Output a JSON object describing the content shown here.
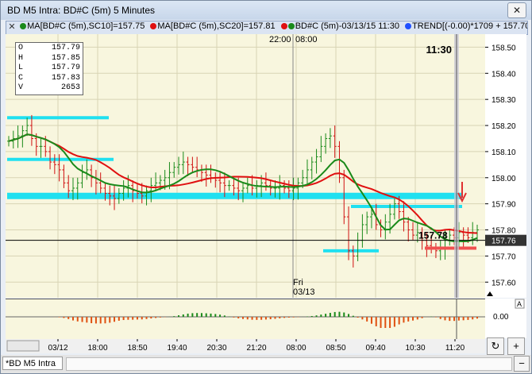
{
  "window": {
    "title": "BD M5 Intra: BD#C (5m) 5 Minutes",
    "close": "✕"
  },
  "legend": {
    "close_x": "✕",
    "items": [
      {
        "text": "MA[BD#C (5m),SC10]=157.75",
        "color": "#1a8a1a"
      },
      {
        "text": "MA[BD#C (5m),SC20]=157.81",
        "color": "#e01010"
      },
      {
        "text": "BD#C (5m)-03/13/15 11:30",
        "color": "#e01010",
        "color2": "#1a8a1a"
      },
      {
        "text": "TREND[(-0.00)*1709 + 157.70",
        "color": "#2050ff"
      }
    ]
  },
  "session": {
    "prev_time": "22:00",
    "open_time": "08:00",
    "day": "Fri",
    "date": "03/13"
  },
  "cursor_time": "11:30",
  "price_tag": "157.76",
  "cross_price": "157.78",
  "ohlc": [
    {
      "k": "O",
      "v": "157.79"
    },
    {
      "k": "H",
      "v": "157.85"
    },
    {
      "k": "L",
      "v": "157.79"
    },
    {
      "k": "C",
      "v": "157.83"
    },
    {
      "k": "V",
      "v": "2653"
    }
  ],
  "y_ticks": [
    "158.50",
    "158.40",
    "158.30",
    "158.20",
    "158.10",
    "158.00",
    "157.90",
    "157.80",
    "157.70",
    "157.60"
  ],
  "lower_tick": "0.00",
  "lower_a": "A",
  "x_ticks": [
    "03/12",
    "18:00",
    "18:50",
    "19:40",
    "20:30",
    "21:20",
    "08:00",
    "08:50",
    "09:40",
    "10:30",
    "11:20",
    "12"
  ],
  "bottom": {
    "tab": "*BD M5 Intra",
    "refresh_icon": "↻",
    "plus": "+",
    "minus": "−"
  },
  "chart_data": {
    "type": "candlestick",
    "ylim": [
      157.54,
      158.55
    ],
    "x_tick_labels": [
      "03/12",
      "18:00",
      "18:50",
      "19:40",
      "20:30",
      "21:20",
      "08:00",
      "08:50",
      "09:40",
      "10:30",
      "11:20",
      "12"
    ],
    "close_prices": [
      158.14,
      158.15,
      158.16,
      158.18,
      158.2,
      158.15,
      158.12,
      158.12,
      158.1,
      158.06,
      158.05,
      158.03,
      157.98,
      157.95,
      157.96,
      157.98,
      158.02,
      158.03,
      158.0,
      157.98,
      157.96,
      157.94,
      157.93,
      157.92,
      157.94,
      157.96,
      157.97,
      157.95,
      157.94,
      157.93,
      157.95,
      157.97,
      157.98,
      157.99,
      158.0,
      158.02,
      158.04,
      158.05,
      158.06,
      158.05,
      158.04,
      158.03,
      158.02,
      158.01,
      158.0,
      157.99,
      157.98,
      157.97,
      157.97,
      157.96,
      157.95,
      157.96,
      157.97,
      157.96,
      157.97,
      157.98,
      157.97,
      157.96,
      157.96,
      157.97,
      157.96,
      157.95,
      157.96,
      157.98,
      158.0,
      158.03,
      158.06,
      158.08,
      158.12,
      158.15,
      158.16,
      158.12,
      158.0,
      157.85,
      157.72,
      157.7,
      157.76,
      157.82,
      157.85,
      157.86,
      157.82,
      157.8,
      157.83,
      157.86,
      157.9,
      157.87,
      157.83,
      157.8,
      157.78,
      157.79,
      157.76,
      157.74,
      157.73,
      157.72,
      157.73,
      157.76,
      157.78,
      157.77,
      157.79,
      157.78,
      157.77,
      157.79,
      157.8
    ],
    "ma10_end": 157.75,
    "ma20_end": 157.81,
    "last": 157.76,
    "cyan_levels": [
      158.23,
      158.07,
      157.93,
      157.72,
      157.89
    ],
    "red_level": 157.73
  }
}
